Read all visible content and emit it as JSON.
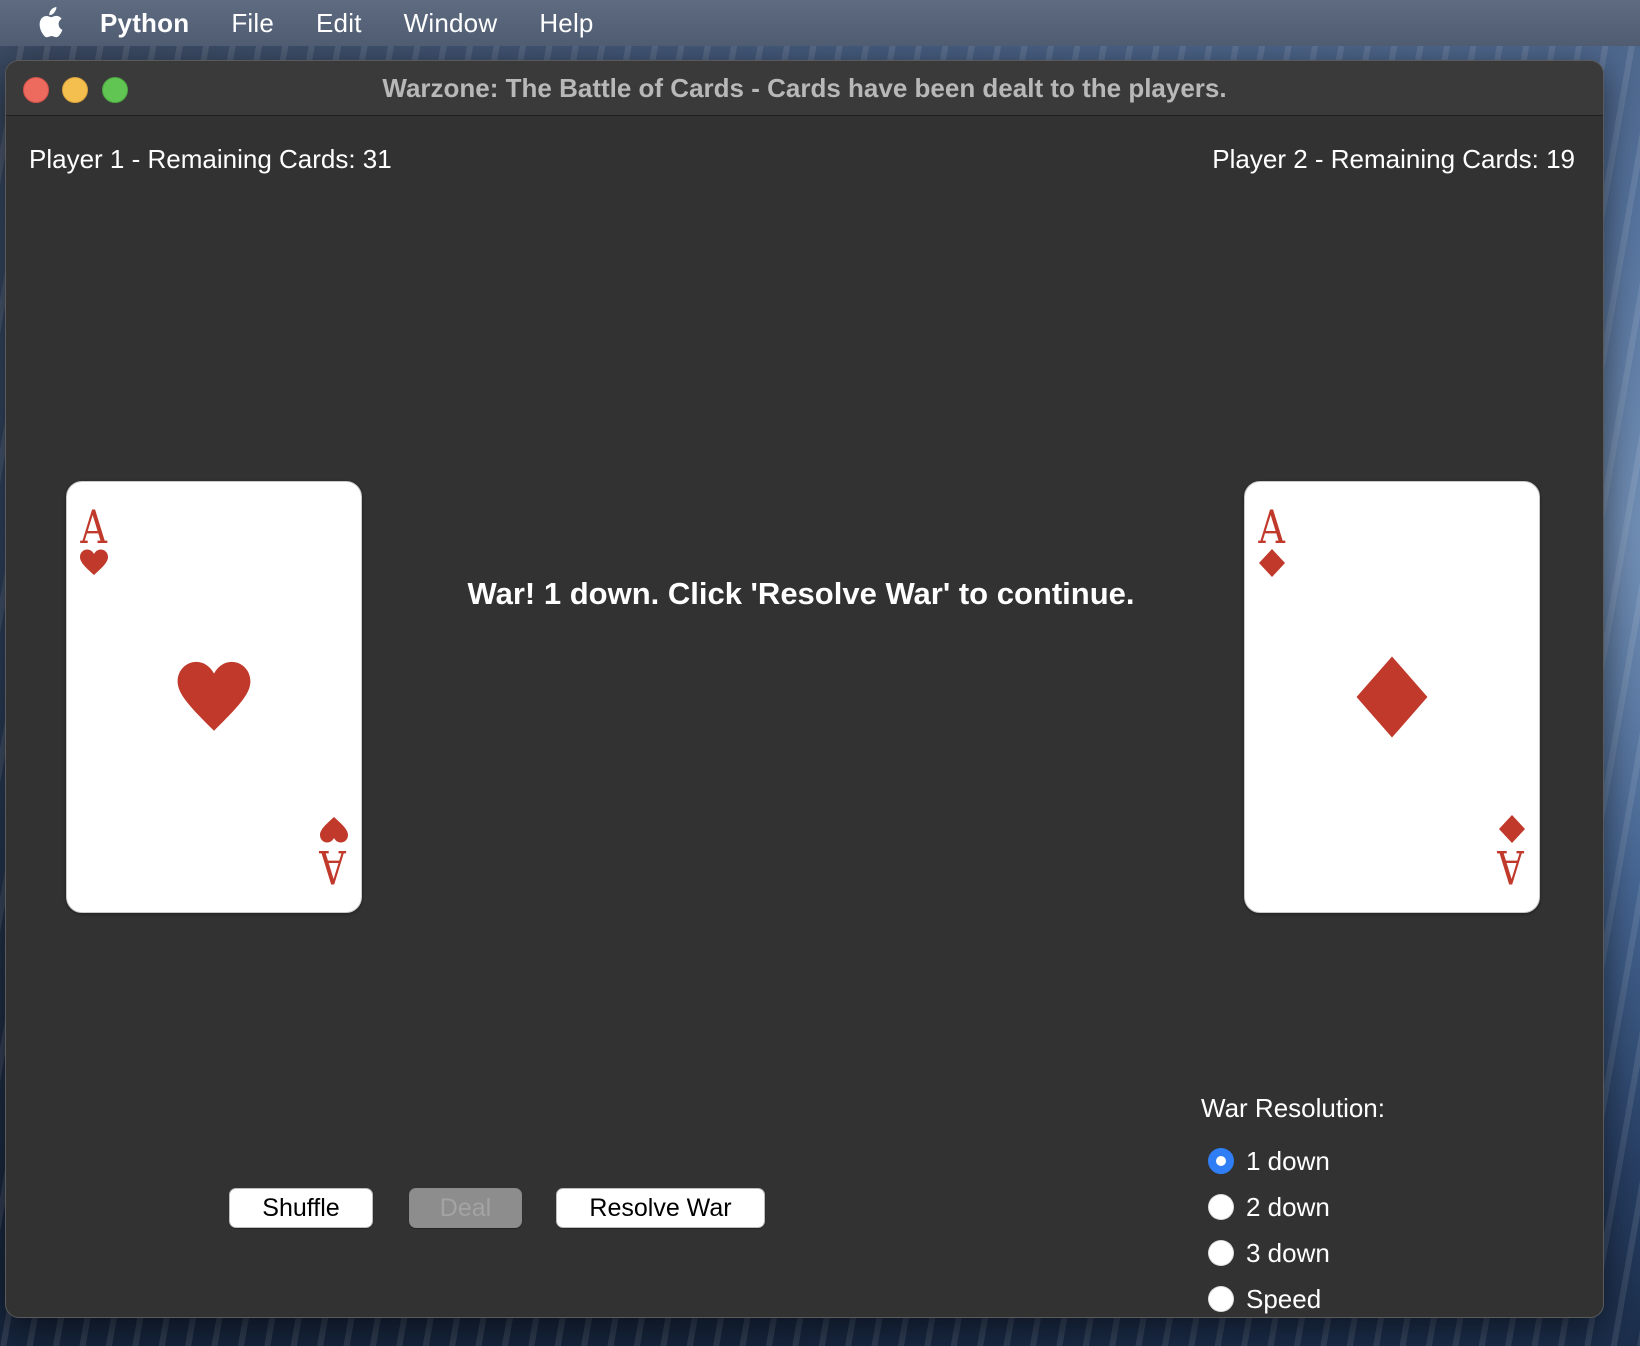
{
  "menubar": {
    "app_name": "Python",
    "items": [
      "File",
      "Edit",
      "Window",
      "Help"
    ]
  },
  "window": {
    "title": "Warzone: The Battle of Cards - Cards have been dealt to the players."
  },
  "players": {
    "p1_label": "Player 1 - Remaining Cards: 31",
    "p2_label": "Player 2 - Remaining Cards: 19"
  },
  "cards": {
    "p1": {
      "rank": "A",
      "suit": "hearts",
      "color": "#c0392b"
    },
    "p2": {
      "rank": "A",
      "suit": "diamonds",
      "color": "#c0392b"
    }
  },
  "status_message": "War! 1 down. Click 'Resolve War' to continue.",
  "buttons": {
    "shuffle": "Shuffle",
    "deal": "Deal",
    "resolve_war": "Resolve War"
  },
  "war_resolution": {
    "heading": "War Resolution:",
    "options": [
      "1 down",
      "2 down",
      "3 down",
      "Speed"
    ],
    "selected": "1 down"
  },
  "colors": {
    "window_bg": "#323232",
    "accent": "#2f7ef6",
    "card_red": "#c0392b"
  }
}
